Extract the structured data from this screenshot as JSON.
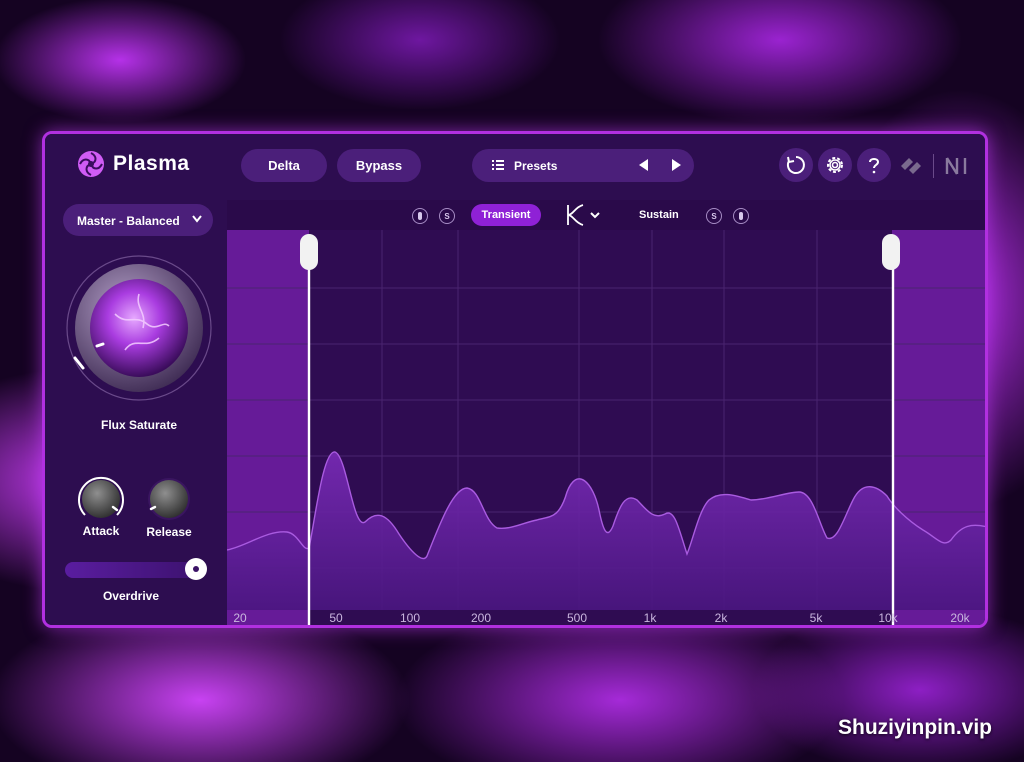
{
  "app": {
    "name": "Plasma",
    "logo_icon": "plasma-swirl-icon"
  },
  "toolbar": {
    "delta_label": "Delta",
    "bypass_label": "Bypass",
    "presets_label": "Presets",
    "icons": [
      "list-icon",
      "previous-arrow-icon",
      "next-arrow-icon",
      "history-icon",
      "gear-icon",
      "help-icon",
      "izotope-logo",
      "ni-logo"
    ]
  },
  "sidebar": {
    "preset_dropdown": "Master - Balanced",
    "main_knob_label": "Flux Saturate",
    "attack_label": "Attack",
    "release_label": "Release",
    "overdrive_label": "Overdrive",
    "overdrive_value": 1.0
  },
  "band_controls": {
    "solo_label": "S",
    "transient_label": "Transient",
    "sustain_label": "Sustain"
  },
  "graph": {
    "freq_labels": [
      "20",
      "50",
      "100",
      "200",
      "500",
      "1k",
      "2k",
      "5k",
      "10k",
      "20k"
    ],
    "low_crossover": "40",
    "high_crossover": "10k"
  },
  "colors": {
    "accent": "#8f21d6",
    "border": "#b130e0",
    "panel": "#2d0d50"
  },
  "watermark": "Shuziyinpin.vip"
}
